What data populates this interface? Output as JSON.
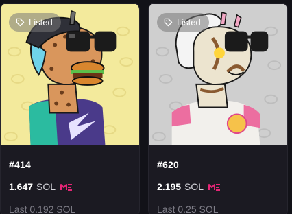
{
  "cards": [
    {
      "badge": "Listed",
      "name": "#414",
      "price_value": "1.647",
      "price_unit": "SOL",
      "last_sale": "Last 0.192 SOL"
    },
    {
      "badge": "Listed",
      "name": "#620",
      "price_value": "2.195",
      "price_unit": "SOL",
      "last_sale": "Last 0.25 SOL"
    }
  ],
  "colors": {
    "page_bg": "#121218",
    "card_bg": "#1b1a22",
    "marketplace_logo": "#e42575",
    "art1_bg": "#f3ea9c",
    "art2_bg": "#cfcfcf"
  },
  "icons": {
    "badge": "tag-icon",
    "marketplace": "magic-eden-logo-icon"
  }
}
